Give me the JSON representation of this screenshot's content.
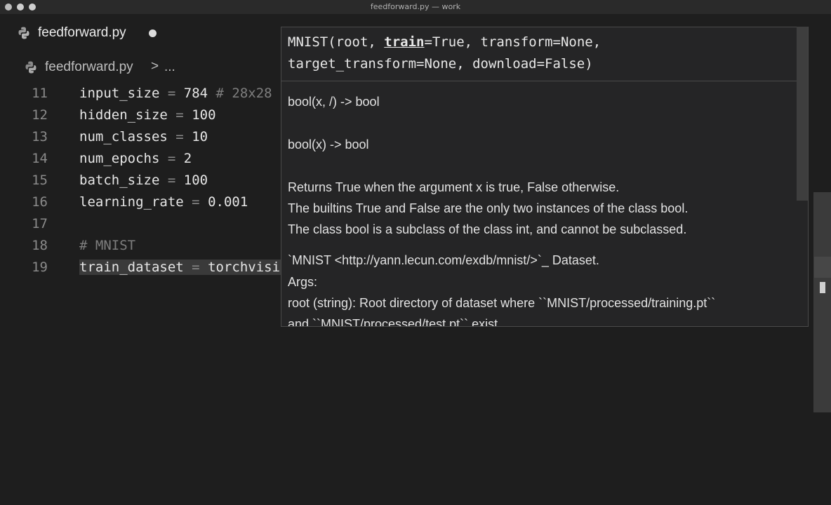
{
  "window": {
    "title": "feedforward.py — work"
  },
  "tab": {
    "label": "feedforward.py",
    "icon": "python-file-icon"
  },
  "breadcrumb": {
    "file": "feedforward.py",
    "separator": ">",
    "more": "..."
  },
  "editor": {
    "lines": [
      {
        "num": "11",
        "name": "input_size",
        "op": "=",
        "value": "784",
        "comment": "# 28x28"
      },
      {
        "num": "12",
        "name": "hidden_size",
        "op": "=",
        "value": "100"
      },
      {
        "num": "13",
        "name": "num_classes",
        "op": "=",
        "value": "10"
      },
      {
        "num": "14",
        "name": "num_epochs",
        "op": "=",
        "value": "2"
      },
      {
        "num": "15",
        "name": "batch_size",
        "op": "=",
        "value": "100"
      },
      {
        "num": "16",
        "name": "learning_rate",
        "op": "=",
        "value": "0.001"
      },
      {
        "num": "17",
        "text": ""
      },
      {
        "num": "18",
        "comment": "# MNIST"
      },
      {
        "num": "19",
        "name": "train_dataset",
        "op": "=",
        "value": "torchvision"
      }
    ]
  },
  "hover": {
    "signature": {
      "line1_pre": "MNIST(root, ",
      "active_param": "train",
      "line1_post": "=True, transform=None,",
      "line2": "target_transform=None, download=False)"
    },
    "doc": [
      "bool(x, /) -> bool",
      "bool(x) -> bool",
      "Returns True when the argument x is true, False otherwise.",
      "The builtins True and False are the only two instances of the class bool.",
      "The class bool is a subclass of the class int, and cannot be subclassed.",
      "`MNIST <http://yann.lecun.com/exdb/mnist/>`_ Dataset.",
      "Args:",
      "root (string): Root directory of dataset where ``MNIST/processed/training.pt``",
      "and  ``MNIST/processed/test.pt`` exist."
    ]
  },
  "colors": {
    "background": "#1e1e1e",
    "hover_background": "#252526",
    "line_numbers": "#8a8a8a"
  }
}
